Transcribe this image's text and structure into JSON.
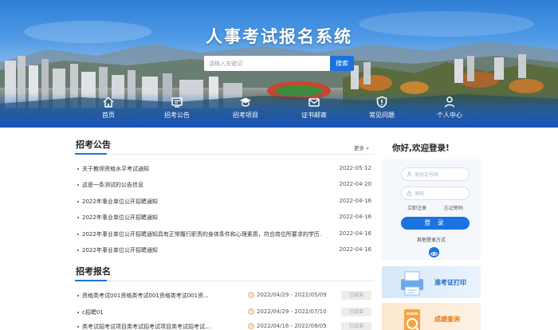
{
  "header": {
    "title": "人事考试报名系统",
    "search_placeholder": "请输入关键词",
    "search_button": "搜索"
  },
  "nav": [
    {
      "label": "首页",
      "icon": "home-icon"
    },
    {
      "label": "招考公告",
      "icon": "notice-board-icon"
    },
    {
      "label": "招考项目",
      "icon": "graduation-cap-icon"
    },
    {
      "label": "证书邮寄",
      "icon": "mail-icon"
    },
    {
      "label": "常见问题",
      "icon": "shield-alert-icon"
    },
    {
      "label": "个人中心",
      "icon": "user-icon"
    }
  ],
  "notices": {
    "title": "招考公告",
    "more": "更多 »",
    "items": [
      {
        "title": "关于教师资格水平考试通知",
        "date": "2022-05-12"
      },
      {
        "title": "这是一条测试的公告信息",
        "date": "2022-04-20"
      },
      {
        "title": "2022年事业单位公开招聘通知",
        "date": "2022-04-16"
      },
      {
        "title": "2022年事业单位公开招聘通知",
        "date": "2022-04-16"
      },
      {
        "title": "2022年事业单位公开招聘通知具有正常履行职责的身体条件和心理素质，符合岗位所要求的学历...",
        "date": "2022-04-16"
      },
      {
        "title": "2022年事业单位公开招聘通知",
        "date": "2022-04-16"
      }
    ]
  },
  "registration": {
    "title": "招考报名",
    "items": [
      {
        "title": "资格类考试001资格类考试001资格类考试001资...",
        "period": "2022/04/29 - 2022/05/09",
        "status": "已结束"
      },
      {
        "title": "c招聘01",
        "period": "2022/04/29 - 2022/07/10",
        "status": "已结束"
      },
      {
        "title": "类考试招考试项目类考试招考试项目类考试招考试...",
        "period": "2022/04/16 - 2022/08/05",
        "status": "已结束"
      }
    ]
  },
  "login": {
    "greeting": "你好,欢迎登录!",
    "id_placeholder": "身份证号码",
    "password_placeholder": "密码",
    "register": "立即注册",
    "forgot": "忘记密码",
    "button": "登 录",
    "other": "其他登录方式"
  },
  "cards": {
    "print": "准考证打印",
    "query": "成绩查询"
  },
  "colors": {
    "accent": "#1a73e0",
    "card_print": "#1a66d0",
    "card_query": "#e07a1a"
  }
}
